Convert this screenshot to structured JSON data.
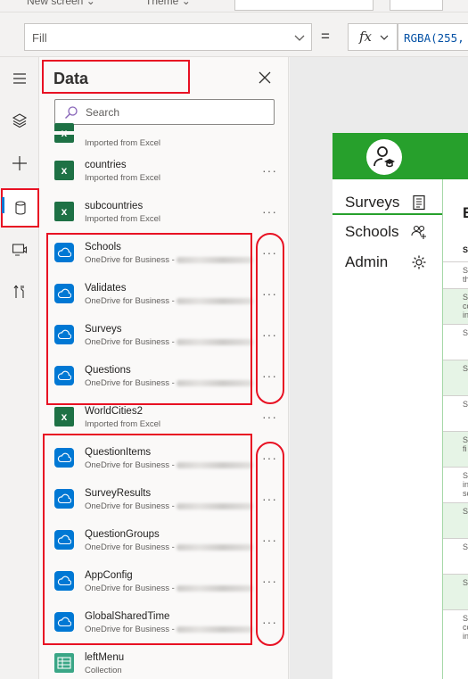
{
  "topbar": {
    "new_screen": "New screen",
    "theme": "Theme"
  },
  "formula_bar": {
    "property": "Fill",
    "equals": "=",
    "fx": "fx",
    "formula": "RGBA(255,"
  },
  "panel": {
    "title": "Data",
    "search_placeholder": "Search",
    "partial_top_item_sub": "Imported from Excel",
    "items": [
      {
        "name": "countries",
        "sub": "Imported from Excel",
        "type": "excel"
      },
      {
        "name": "subcountries",
        "sub": "Imported from Excel",
        "type": "excel"
      },
      {
        "name": "Schools",
        "sub": "OneDrive for Business -",
        "type": "onedrive"
      },
      {
        "name": "Validates",
        "sub": "OneDrive for Business -",
        "type": "onedrive"
      },
      {
        "name": "Surveys",
        "sub": "OneDrive for Business -",
        "type": "onedrive"
      },
      {
        "name": "Questions",
        "sub": "OneDrive for Business -",
        "type": "onedrive"
      },
      {
        "name": "WorldCities2",
        "sub": "Imported from Excel",
        "type": "excel"
      },
      {
        "name": "QuestionItems",
        "sub": "OneDrive for Business -",
        "type": "onedrive"
      },
      {
        "name": "SurveyResults",
        "sub": "OneDrive for Business -",
        "type": "onedrive"
      },
      {
        "name": "QuestionGroups",
        "sub": "OneDrive for Business -",
        "type": "onedrive"
      },
      {
        "name": "AppConfig",
        "sub": "OneDrive for Business -",
        "type": "onedrive"
      },
      {
        "name": "GlobalSharedTime",
        "sub": "OneDrive for Business -",
        "type": "onedrive"
      },
      {
        "name": "leftMenu",
        "sub": "Collection",
        "type": "collection"
      }
    ],
    "more_label": "···"
  },
  "app_preview": {
    "nav": [
      "Surveys",
      "Schools",
      "Admin"
    ],
    "heading_partial": "E",
    "column_partial": "S",
    "rows": [
      "S\nth",
      "S\nco\nin",
      "S",
      "S",
      "S",
      "S\nfi",
      "S\nin\nsc",
      "S",
      "S",
      "S",
      "S\nco\nin"
    ]
  },
  "colors": {
    "app_header": "#27a02c",
    "highlight": "#e81123",
    "onedrive": "#0078d4",
    "excel": "#1e7145"
  }
}
